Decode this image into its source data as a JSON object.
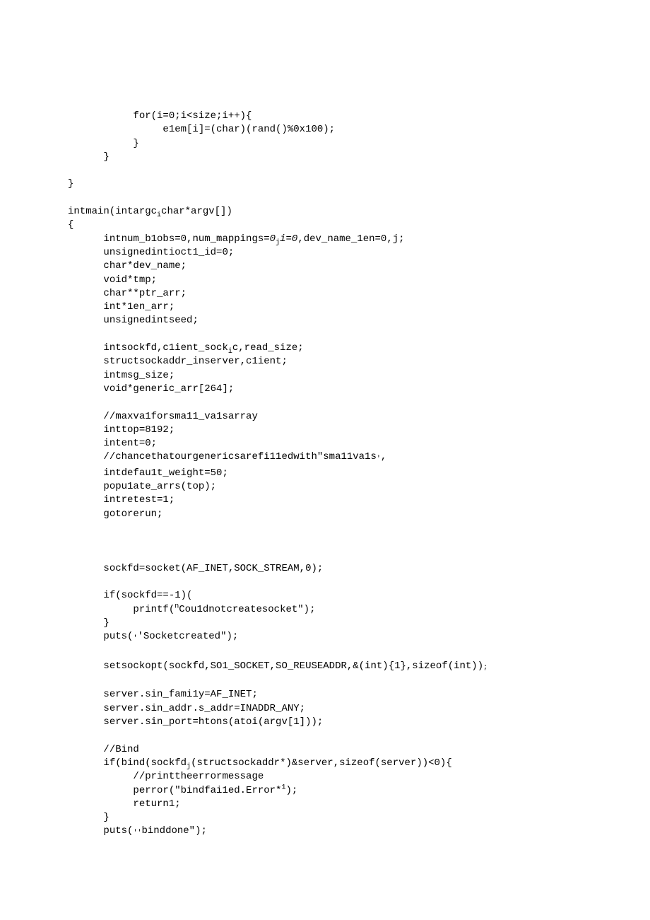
{
  "code_lines": [
    "           for(i=0;i<size;i++){",
    "                elem[i]=(char)(rand()%0x100);",
    "           }",
    "      }",
    "",
    "}",
    "",
    "intmain(intargc,char*argv[])",
    "{",
    "      intnum_blobs=0,num_mappings=0,i=0,dev_name_len=0,j;",
    "      unsignedintioctl_id=0;",
    "      char*dev_name;",
    "      void*tmp;",
    "      char**ptr_arr;",
    "      int*len_arr;",
    "      unsignedintseed;",
    "",
    "      intsockfd,client_sock,c,read_size;",
    "      structsockaddr_inserver,client;",
    "      intmsg_size;",
    "      void*generic_arr[264];",
    "",
    "      //maxvalforsmall_valsarray",
    "      inttop=8192;",
    "      intent=0;",
    "      //chancethatourgenericsarefilledwith\"smallvals'",
    "      intdefault_weight=50;",
    "      populate_arrs(top);",
    "      intretest=1;",
    "      gotorerun;",
    "",
    "",
    "",
    "      sockfd=socket(AF_INET,SOCK_STREAM,0);",
    "",
    "      if(sockfd==-1)(",
    "           printf(\"Couldnotcreatesocket\");",
    "      }",
    "      puts(''Socketcreated\");",
    "",
    "      setsockopt(sockfd,SOl_SOCKET,SO_REUSEADDR,&(int){1},sizeof(int));",
    "",
    "      server.sin_family=AF_INET;",
    "      server.sin_addr.s_addr=INADDR_ANY;",
    "      server.sin_port=htons(atoi(argv[1]));",
    "",
    "      //Bind",
    "      if(bind(sockfd,(structsockaddr*)&server,sizeof(server))<0){",
    "           //printtheerrormessage",
    "           perror(\"bindfailed.Error*1);",
    "           return1;",
    "      }",
    "      puts(''binddone\");"
  ],
  "render_lines": [
    {
      "indent": 11,
      "segs": [
        {
          "t": "for(i=0;i<size;i++){"
        }
      ]
    },
    {
      "indent": 16,
      "segs": [
        {
          "t": "e1em[i]=(char)(rand()%0x100);"
        }
      ]
    },
    {
      "indent": 11,
      "segs": [
        {
          "t": "}"
        }
      ]
    },
    {
      "indent": 6,
      "segs": [
        {
          "t": "}"
        }
      ]
    },
    {
      "indent": 0,
      "segs": []
    },
    {
      "indent": 0,
      "segs": [
        {
          "t": "}"
        }
      ]
    },
    {
      "indent": 0,
      "segs": []
    },
    {
      "indent": 0,
      "segs": [
        {
          "t": "intmain("
        },
        {
          "t": "intargc"
        },
        {
          "t": "i",
          "cls": "sub"
        },
        {
          "t": "char*argv[])"
        }
      ]
    },
    {
      "indent": 0,
      "segs": [
        {
          "t": "{"
        }
      ]
    },
    {
      "indent": 6,
      "segs": [
        {
          "t": "intnum_b1obs=0,num_mappings="
        },
        {
          "t": "0",
          "cls": "italic"
        },
        {
          "t": "j",
          "cls": "sub"
        },
        {
          "t": "i=0",
          "cls": "italic"
        },
        {
          "t": ",dev_name_1en=0,j;"
        }
      ]
    },
    {
      "indent": 6,
      "segs": [
        {
          "t": "unsignedintioct1_id=0;"
        }
      ]
    },
    {
      "indent": 6,
      "segs": [
        {
          "t": "char*dev_name;"
        }
      ]
    },
    {
      "indent": 6,
      "segs": [
        {
          "t": "void*tmp;"
        }
      ]
    },
    {
      "indent": 6,
      "segs": [
        {
          "t": "char**ptr_arr;"
        }
      ]
    },
    {
      "indent": 6,
      "segs": [
        {
          "t": "int*1en_arr;"
        }
      ]
    },
    {
      "indent": 6,
      "segs": [
        {
          "t": "unsignedintseed;"
        }
      ]
    },
    {
      "indent": 0,
      "segs": []
    },
    {
      "indent": 6,
      "segs": [
        {
          "t": "intsockfd,c1ient_sock"
        },
        {
          "t": "i",
          "cls": "sub"
        },
        {
          "t": "c,read_size;"
        }
      ]
    },
    {
      "indent": 6,
      "segs": [
        {
          "t": "structsockaddr_inserver,c1ient;"
        }
      ]
    },
    {
      "indent": 6,
      "segs": [
        {
          "t": "intmsg_size;"
        }
      ]
    },
    {
      "indent": 6,
      "segs": [
        {
          "t": "void*generic_arr[264];"
        }
      ]
    },
    {
      "indent": 0,
      "segs": []
    },
    {
      "indent": 6,
      "segs": [
        {
          "t": "//maxva1forsma11_va1sarray"
        }
      ]
    },
    {
      "indent": 6,
      "segs": [
        {
          "t": "inttop=8192;"
        }
      ]
    },
    {
      "indent": 6,
      "segs": [
        {
          "t": "intent=0;"
        }
      ]
    },
    {
      "indent": 6,
      "segs": [
        {
          "t": "//chancethatourgenericsarefi11edwith\"sma11va1s"
        },
        {
          "t": "'",
          "cls": "low"
        },
        {
          "t": ","
        }
      ]
    },
    {
      "indent": 6,
      "segs": [
        {
          "t": "intdefau1t_weight=50;"
        }
      ]
    },
    {
      "indent": 6,
      "segs": [
        {
          "t": "popu1ate_arrs(top);"
        }
      ]
    },
    {
      "indent": 6,
      "segs": [
        {
          "t": "intretest=1;"
        }
      ]
    },
    {
      "indent": 6,
      "segs": [
        {
          "t": "gotorerun;"
        }
      ]
    },
    {
      "indent": 0,
      "segs": []
    },
    {
      "indent": 0,
      "segs": []
    },
    {
      "indent": 0,
      "segs": []
    },
    {
      "indent": 6,
      "segs": [
        {
          "t": "sockfd=socket(AF_INET,SOCK_STREAM,0);"
        }
      ]
    },
    {
      "indent": 0,
      "segs": []
    },
    {
      "indent": 6,
      "segs": [
        {
          "t": "if(sockfd==-1)("
        }
      ]
    },
    {
      "indent": 11,
      "segs": [
        {
          "t": "printf("
        },
        {
          "t": "n",
          "cls": "supern"
        },
        {
          "t": "Cou1dnotcreatesocket\");"
        }
      ]
    },
    {
      "indent": 6,
      "segs": [
        {
          "t": "}"
        }
      ]
    },
    {
      "indent": 6,
      "segs": [
        {
          "t": "puts("
        },
        {
          "t": "'",
          "cls": "low"
        },
        {
          "t": "'Socketcreated\");"
        }
      ]
    },
    {
      "indent": 0,
      "segs": []
    },
    {
      "indent": 6,
      "segs": [
        {
          "t": "setsockopt(sockfd,SO1_SOCKET,SO_REUSEADDR,&(int){1},sizeof(int))"
        },
        {
          "t": ";",
          "cls": "semicolon"
        }
      ]
    },
    {
      "indent": 0,
      "segs": []
    },
    {
      "indent": 6,
      "segs": [
        {
          "t": "server.sin_fami1y=AF_INET;"
        }
      ]
    },
    {
      "indent": 6,
      "segs": [
        {
          "t": "server.sin_addr.s_addr=INADDR_ANY;"
        }
      ]
    },
    {
      "indent": 6,
      "segs": [
        {
          "t": "server.sin_port=htons(atoi(argv[1]));"
        }
      ]
    },
    {
      "indent": 0,
      "segs": []
    },
    {
      "indent": 6,
      "segs": [
        {
          "t": "//Bind"
        }
      ]
    },
    {
      "indent": 6,
      "segs": [
        {
          "t": "if(bind(sockfd"
        },
        {
          "t": "j",
          "cls": "sub"
        },
        {
          "t": "(structsockaddr*)&server,sizeof(server))<0){"
        }
      ]
    },
    {
      "indent": 11,
      "segs": [
        {
          "t": "//printtheerrormessage"
        }
      ]
    },
    {
      "indent": 11,
      "segs": [
        {
          "t": "perror(\"bindfai1ed.Error*"
        },
        {
          "t": "1",
          "cls": "sup"
        },
        {
          "t": ");"
        }
      ]
    },
    {
      "indent": 11,
      "segs": [
        {
          "t": "return1;"
        }
      ]
    },
    {
      "indent": 6,
      "segs": [
        {
          "t": "}"
        }
      ]
    },
    {
      "indent": 6,
      "segs": [
        {
          "t": "puts("
        },
        {
          "t": "'",
          "cls": "low"
        },
        {
          "t": "'",
          "cls": "low"
        },
        {
          "t": "binddone\");"
        }
      ]
    }
  ]
}
